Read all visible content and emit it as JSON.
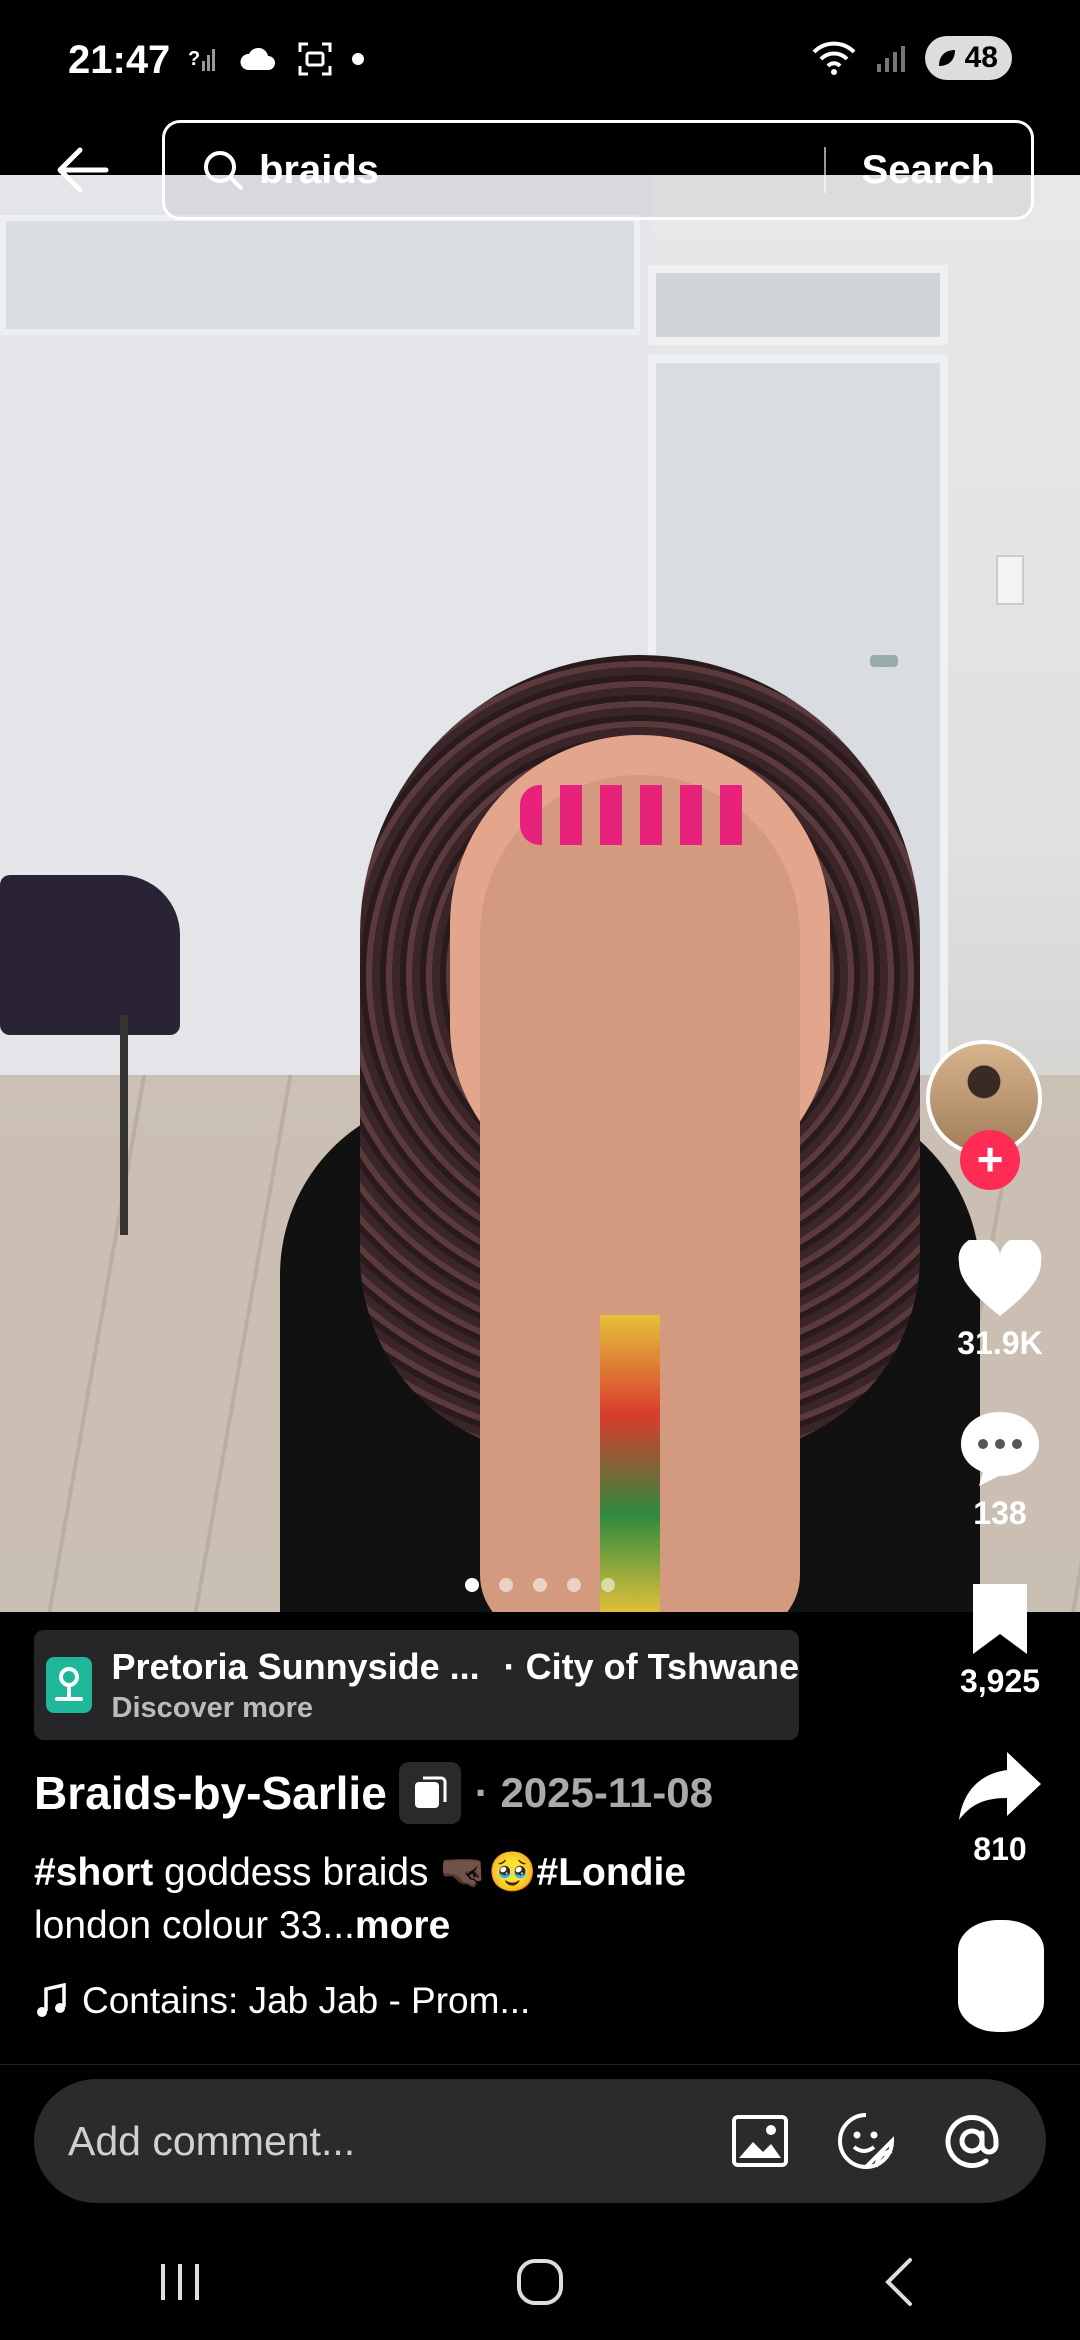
{
  "status_bar": {
    "time": "21:47",
    "battery": "48"
  },
  "search": {
    "query": "braids",
    "button_label": "Search"
  },
  "carousel": {
    "total": 5,
    "active_index": 0
  },
  "actions": {
    "likes": "31.9K",
    "comments": "138",
    "saves": "3,925",
    "shares": "810",
    "follow_symbol": "+"
  },
  "location": {
    "place": "Pretoria Sunnyside ...",
    "city": "· City of Tshwane",
    "discover": "Discover more"
  },
  "post": {
    "author": "Braids-by-Sarlie",
    "date": "· 2025-11-08",
    "caption_tag1": "#short",
    "caption_text": " goddess braids 🤜🏿🥹",
    "caption_tag2": "#Londie",
    "caption_line2": "london colour 33...",
    "more_label": "more",
    "music": "Contains: Jab Jab - Prom..."
  },
  "comment": {
    "placeholder": "Add comment..."
  },
  "colors": {
    "accent": "#fe2c55",
    "location_icon": "#1fb79a",
    "comment_bg": "#2b2b2d"
  }
}
